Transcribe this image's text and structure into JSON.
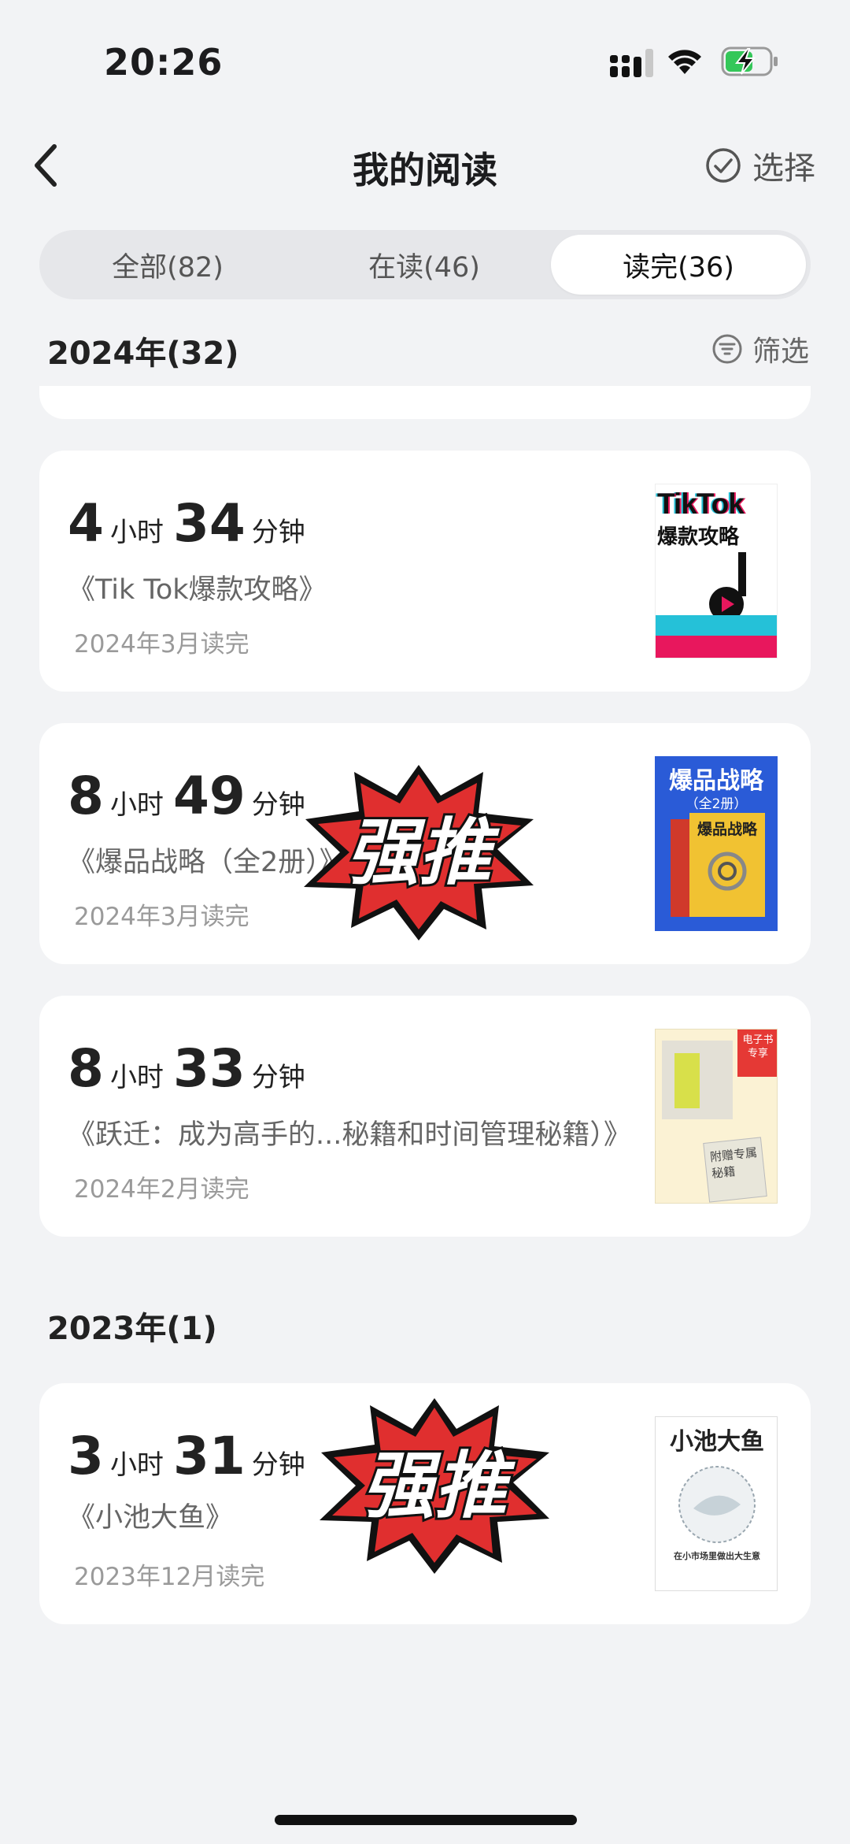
{
  "status": {
    "time": "20:26"
  },
  "nav": {
    "title": "我的阅读",
    "select_label": "选择"
  },
  "tabs": [
    {
      "label": "全部(82)",
      "active": false
    },
    {
      "label": "在读(46)",
      "active": false
    },
    {
      "label": "读完(36)",
      "active": true
    }
  ],
  "sections": [
    {
      "header": "2024年(32)",
      "filter_label": "筛选",
      "books": [
        {
          "hours": "4",
          "minutes": "34",
          "hour_unit": "小时",
          "minute_unit": "分钟",
          "title": "《Tik Tok爆款攻略》",
          "date": "2024年3月读完",
          "cover": {
            "title": "TikTok",
            "subtitle": "爆款攻略",
            "colors": [
              "#ffffff",
              "#e8175d",
              "#25c1d8"
            ]
          }
        },
        {
          "hours": "8",
          "minutes": "49",
          "hour_unit": "小时",
          "minute_unit": "分钟",
          "title": "《爆品战略（全2册）》",
          "date": "2024年3月读完",
          "sticker": "强推",
          "cover": {
            "title": "爆品战略",
            "subtitle": "（全2册）",
            "inner_title": "爆品战略",
            "colors": [
              "#2a5bd7",
              "#f1c232"
            ]
          }
        },
        {
          "hours": "8",
          "minutes": "33",
          "hour_unit": "小时",
          "minute_unit": "分钟",
          "title": "《跃迁：成为高手的...秘籍和时间管理秘籍）》",
          "date": "2024年2月读完",
          "cover": {
            "badge_line1": "电子书",
            "badge_line2": "专享",
            "note": "附赠专属秘籍",
            "colors": [
              "#fbf2d4",
              "#e53935"
            ]
          }
        }
      ]
    },
    {
      "header": "2023年(1)",
      "books": [
        {
          "hours": "3",
          "minutes": "31",
          "hour_unit": "小时",
          "minute_unit": "分钟",
          "title": "《小池大鱼》",
          "date": "2023年12月读完",
          "sticker": "强推",
          "cover": {
            "title": "小池大鱼",
            "subtitle": "在小市场里做出大生意",
            "colors": [
              "#ffffff",
              "#222222"
            ]
          }
        }
      ]
    }
  ]
}
